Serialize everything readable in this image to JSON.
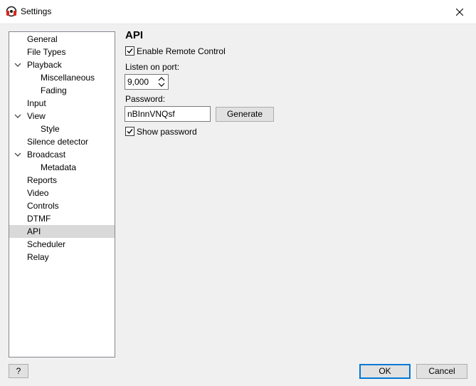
{
  "window": {
    "title": "Settings",
    "app_icon": "headphones-icon",
    "close_icon": "close-icon"
  },
  "tree": {
    "items": [
      {
        "label": "General",
        "level": 0
      },
      {
        "label": "File Types",
        "level": 0
      },
      {
        "label": "Playback",
        "level": 0,
        "expanded": true
      },
      {
        "label": "Miscellaneous",
        "level": 1
      },
      {
        "label": "Fading",
        "level": 1
      },
      {
        "label": "Input",
        "level": 0
      },
      {
        "label": "View",
        "level": 0,
        "expanded": true
      },
      {
        "label": "Style",
        "level": 1
      },
      {
        "label": "Silence detector",
        "level": 0
      },
      {
        "label": "Broadcast",
        "level": 0,
        "expanded": true
      },
      {
        "label": "Metadata",
        "level": 1
      },
      {
        "label": "Reports",
        "level": 0
      },
      {
        "label": "Video",
        "level": 0
      },
      {
        "label": "Controls",
        "level": 0
      },
      {
        "label": "DTMF",
        "level": 0
      },
      {
        "label": "API",
        "level": 0,
        "selected": true
      },
      {
        "label": "Scheduler",
        "level": 0
      },
      {
        "label": "Relay",
        "level": 0
      }
    ]
  },
  "panel": {
    "title": "API",
    "enable_remote_label": "Enable Remote Control",
    "enable_remote_checked": true,
    "port_label": "Listen on port:",
    "port_value": "9,000",
    "password_label": "Password:",
    "password_value": "nBInnVNQsf",
    "generate_label": "Generate",
    "show_password_label": "Show password",
    "show_password_checked": true
  },
  "footer": {
    "help_label": "?",
    "ok_label": "OK",
    "cancel_label": "Cancel"
  },
  "colors": {
    "selection": "#d9d9d9",
    "default_button_border": "#0078d7",
    "icon_red": "#d9261c"
  }
}
